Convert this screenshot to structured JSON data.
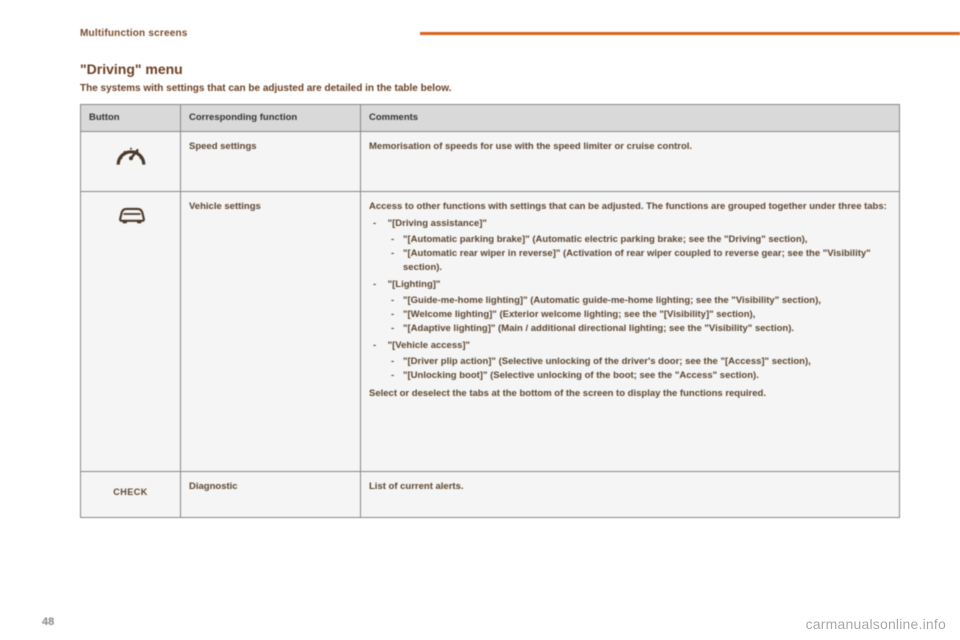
{
  "section_breadcrumb": "Multifunction screens",
  "heading": "\"Driving\" menu",
  "intro": "The systems with settings that can be adjusted are detailed in the table below.",
  "table": {
    "headers": {
      "button": "Button",
      "function": "Corresponding function",
      "comments": "Comments"
    },
    "rows": [
      {
        "icon": "speedometer-icon",
        "function": "Speed settings",
        "comments": "Memorisation of speeds for use with the speed limiter or cruise control."
      },
      {
        "icon": "car-icon",
        "function": "Vehicle settings",
        "comments_intro": "Access to other functions with settings that can be adjusted. The functions are grouped together under three tabs:",
        "tabs": [
          {
            "label": "\"[Driving assistance]\"",
            "items": [
              "\"[Automatic parking brake]\" (Automatic electric parking brake; see the \"Driving\" section),",
              "\"[Automatic rear wiper in reverse]\" (Activation of rear wiper coupled to reverse gear; see the \"Visibility\" section)."
            ]
          },
          {
            "label": "\"[Lighting]\"",
            "items": [
              "\"[Guide-me-home lighting]\" (Automatic guide-me-home lighting; see the \"Visibility\" section),",
              "\"[Welcome lighting]\" (Exterior welcome lighting; see the \"[Visibility]\" section),",
              "\"[Adaptive lighting]\" (Main / additional directional lighting; see the \"Visibility\" section)."
            ]
          },
          {
            "label": "\"[Vehicle access]\"",
            "items": [
              "\"[Driver plip action]\" (Selective unlocking of the driver's door; see the \"[Access]\" section),",
              "\"[Unlocking boot]\" (Selective unlocking of the boot; see the \"Access\" section)."
            ]
          }
        ],
        "comments_outro": "Select or deselect the tabs at the bottom of the screen to display the functions required."
      },
      {
        "icon": "check-text",
        "icon_text": "CHECK",
        "function": "Diagnostic",
        "comments": "List of current alerts."
      }
    ]
  },
  "page_number": "48",
  "watermark": "carmanualsonline.info"
}
